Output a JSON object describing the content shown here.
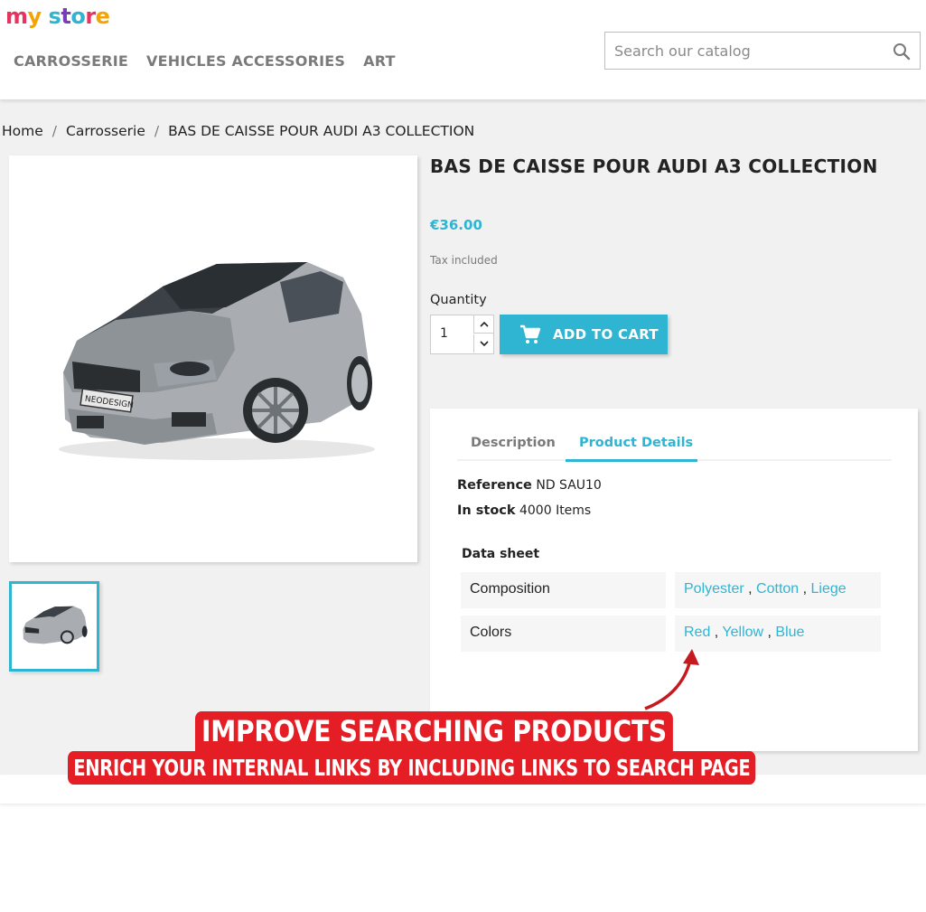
{
  "logo": {
    "text": "my store"
  },
  "nav": {
    "items": [
      "CARROSSERIE",
      "VEHICLES ACCESSORIES",
      "ART"
    ]
  },
  "search": {
    "placeholder": "Search our catalog",
    "icon": "search-icon"
  },
  "breadcrumb": {
    "items": [
      "Home",
      "Carrosserie",
      "BAS DE CAISSE POUR AUDI A3 COLLECTION"
    ],
    "separator": "/"
  },
  "product": {
    "title": "BAS DE CAISSE POUR AUDI A3 COLLECTION",
    "price": "€36.00",
    "tax_note": "Tax included",
    "quantity_label": "Quantity",
    "quantity_value": "1",
    "add_to_cart": "ADD TO CART",
    "brand_plate": "NEODESIGN"
  },
  "tabs": {
    "description": "Description",
    "details": "Product Details",
    "active": "details"
  },
  "details": {
    "reference_label": "Reference",
    "reference_value": "ND SAU10",
    "stock_label": "In stock",
    "stock_value": "4000 Items",
    "data_sheet_title": "Data sheet",
    "rows": [
      {
        "name": "Composition",
        "values": [
          "Polyester",
          "Cotton",
          "Liege"
        ]
      },
      {
        "name": "Colors",
        "values": [
          "Red",
          "Yellow",
          "Blue"
        ]
      }
    ]
  },
  "promo": {
    "headline": "IMPROVE SEARCHING PRODUCTS",
    "subline": "ENRICH YOUR INTERNAL LINKS BY INCLUDING LINKS TO SEARCH PAGE"
  },
  "colors": {
    "accent": "#2fb5d2",
    "banner": "#e51d24",
    "background": "#f1f1f1"
  }
}
